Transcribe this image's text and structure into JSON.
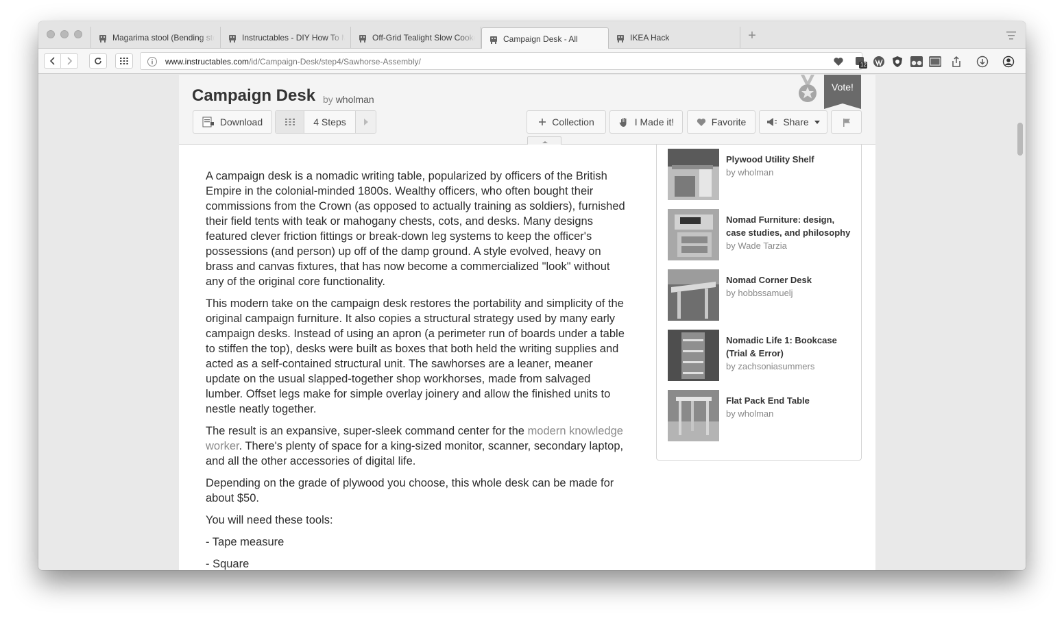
{
  "browser": {
    "tabs": [
      {
        "label": "Magarima stool (Bending stool)",
        "active": false
      },
      {
        "label": "Instructables - DIY How To Make",
        "active": false
      },
      {
        "label": "Off-Grid Tealight Slow Cooker",
        "active": false
      },
      {
        "label": "Campaign Desk - All",
        "active": true
      },
      {
        "label": "IKEA Hack",
        "active": false
      }
    ],
    "new_tab_label": "+",
    "url_host": "www.instructables.com",
    "url_path": "/id/Campaign-Desk/step4/Sawhorse-Assembly/",
    "extension_badge": "12"
  },
  "header": {
    "title": "Campaign Desk",
    "by_prefix": "by",
    "author": "wholman",
    "vote_label": "Vote!",
    "download_label": "Download",
    "steps_label": "4 Steps",
    "collection_label": "Collection",
    "made_it_label": "I Made it!",
    "favorite_label": "Favorite",
    "share_label": "Share"
  },
  "article": {
    "p1": "A campaign desk is a nomadic writing table, popularized by officers of the British Empire in the colonial-minded 1800s. Wealthy officers, who often bought their commissions from the Crown (as opposed to actually training as soldiers), furnished their field tents with teak or mahogany chests, cots, and desks. Many designs featured clever friction fittings or break-down leg systems to keep the officer's possessions (and person) up off of the damp ground. A style evolved, heavy on brass and canvas fixtures, that has now become a commercialized \"look\" without any of the original core functionality.",
    "p2": "This modern take on the campaign desk restores the portability and simplicity of the original campaign furniture. It also copies a structural strategy used by many early campaign desks. Instead of using an apron (a perimeter run of boards under a table to stiffen the top), desks were built as boxes that both held the writing supplies and acted as a self-contained structural unit. The sawhorses are a leaner, meaner update on the usual slapped-together shop workhorses, made from salvaged lumber. Offset legs make for simple overlay joinery and allow the finished units to nestle neatly together.",
    "p3_before": "The result is an expansive, super-sleek command center for the ",
    "p3_link": "modern knowledge worker",
    "p3_after": ". There's plenty of space for a king-sized monitor, scanner, secondary laptop, and all the other accessories of digital life.",
    "p4": "Depending on the grade of plywood you choose, this whole desk can be made for about $50.",
    "p5": "You will need these tools:",
    "tool1": "- Tape measure",
    "tool2": "- Square"
  },
  "related": [
    {
      "title": "Plywood Utility Shelf",
      "by": "by",
      "author": "wholman"
    },
    {
      "title": "Nomad Furniture: design, case studies, and philosophy",
      "by": "by",
      "author": "Wade Tarzia"
    },
    {
      "title": "Nomad Corner Desk",
      "by": "by",
      "author": "hobbssamuelj"
    },
    {
      "title": "Nomadic Life 1: Bookcase (Trial & Error)",
      "by": "by",
      "author": "zachsoniasummers"
    },
    {
      "title": "Flat Pack End Table",
      "by": "by",
      "author": "wholman"
    }
  ]
}
